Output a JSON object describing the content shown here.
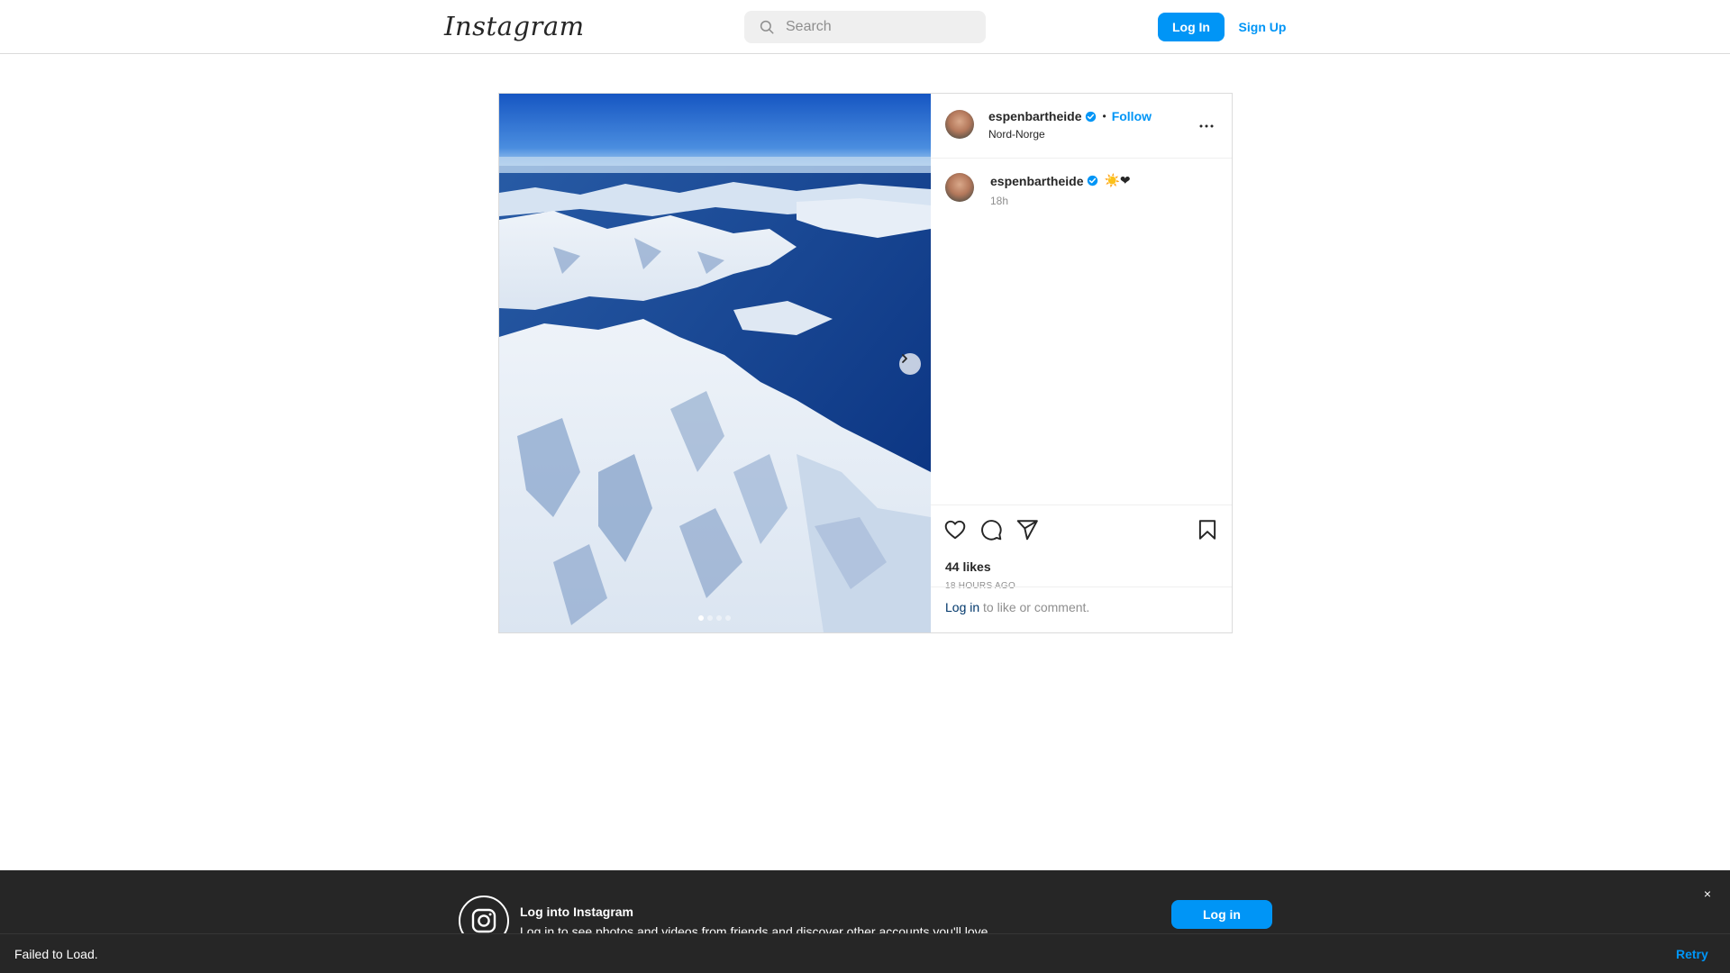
{
  "header": {
    "logo_text": "Instagram",
    "search_placeholder": "Search",
    "login_label": "Log In",
    "signup_label": "Sign Up"
  },
  "post": {
    "username": "espenbartheide",
    "follow_label": "Follow",
    "separator": "•",
    "location": "Nord-Norge",
    "caption": "☀️❤",
    "caption_time": "18h",
    "likes": "44 likes",
    "time_ago": "18 HOURS AGO",
    "login_link": "Log in",
    "login_suffix": " to like or comment.",
    "carousel_count": 4,
    "carousel_active": 1
  },
  "banner": {
    "title": "Log into Instagram",
    "subtitle": "Log in to see photos and videos from friends and discover other accounts you'll love.",
    "login_label": "Log in",
    "close_label": "×"
  },
  "status": {
    "message": "Failed to Load.",
    "retry_label": "Retry"
  },
  "colors": {
    "accent": "#0095f6",
    "link_dark": "#00376b",
    "banner_bg": "#262626"
  },
  "icons": [
    "search-icon",
    "verified-icon",
    "more-icon",
    "chevron-right-icon",
    "heart-icon",
    "comment-icon",
    "share-icon",
    "bookmark-icon",
    "instagram-glyph-icon"
  ]
}
